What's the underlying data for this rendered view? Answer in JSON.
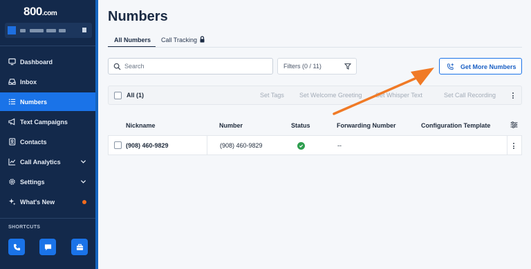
{
  "brand": {
    "logo": "800",
    "logo_suffix": ".com"
  },
  "sidebar": {
    "items": [
      {
        "label": "Dashboard",
        "icon": "monitor-icon"
      },
      {
        "label": "Inbox",
        "icon": "inbox-icon"
      },
      {
        "label": "Numbers",
        "icon": "list-icon",
        "active": true
      },
      {
        "label": "Text Campaigns",
        "icon": "megaphone-icon"
      },
      {
        "label": "Contacts",
        "icon": "contacts-icon"
      },
      {
        "label": "Call Analytics",
        "icon": "chart-icon",
        "expandable": true
      },
      {
        "label": "Settings",
        "icon": "gear-icon",
        "expandable": true
      },
      {
        "label": "What's New",
        "icon": "sparkle-icon",
        "badge_color": "#f26b1d"
      }
    ],
    "shortcuts_label": "SHORTCUTS",
    "shortcuts": [
      "phone-icon",
      "message-icon",
      "briefcase-icon"
    ]
  },
  "page": {
    "title": "Numbers",
    "tabs": [
      {
        "label": "All Numbers",
        "active": true
      },
      {
        "label": "Call Tracking",
        "locked": true
      }
    ]
  },
  "toolbar": {
    "search_placeholder": "Search",
    "filters_label": "Filters (0 / 11)",
    "get_more_label": "Get More Numbers"
  },
  "bulk": {
    "all_label": "All (1)",
    "actions": [
      "Set Tags",
      "Set Welcome Greeting",
      "Set Whisper Text",
      "Set Call Recording"
    ]
  },
  "table": {
    "columns": [
      "Nickname",
      "Number",
      "Status",
      "Forwarding Number",
      "Configuration Template"
    ],
    "rows": [
      {
        "nickname": "(908) 460-9829",
        "number": "(908) 460-9829",
        "status": "active",
        "forwarding": "--",
        "template": ""
      }
    ]
  },
  "colors": {
    "sidebar_bg": "#13294b",
    "accent": "#1a73e8",
    "annotation_arrow": "#f07a26",
    "status_ok": "#2e9e4f"
  }
}
